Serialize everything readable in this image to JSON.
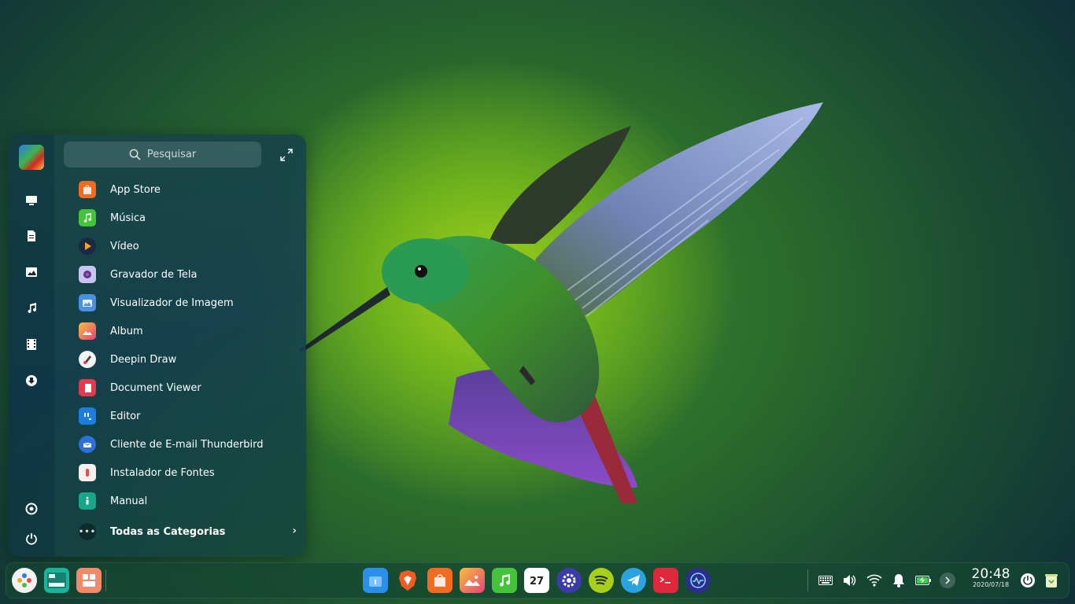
{
  "wallpaper": {
    "subject": "hummingbird",
    "accent": "#8fcf1e"
  },
  "launcher": {
    "avatar_icon": "user-avatar-parrot-icon",
    "sidebar": [
      {
        "icon": "computer-icon"
      },
      {
        "icon": "document-icon"
      },
      {
        "icon": "picture-icon"
      },
      {
        "icon": "music-icon"
      },
      {
        "icon": "video-icon"
      },
      {
        "icon": "download-icon"
      },
      {
        "icon": "settings-icon"
      },
      {
        "icon": "power-icon"
      }
    ],
    "search_placeholder": "Pesquisar",
    "apps": [
      {
        "label": "App Store",
        "icon": "app-store-icon",
        "color": "#f26b21"
      },
      {
        "label": "Música",
        "icon": "music-app-icon",
        "color": "#45c43b"
      },
      {
        "label": "Vídeo",
        "icon": "video-app-icon",
        "color": "#2c6bd6"
      },
      {
        "label": "Gravador de Tela",
        "icon": "screen-recorder-icon",
        "color": "#c9c3f0"
      },
      {
        "label": "Visualizador de Imagem",
        "icon": "image-viewer-icon",
        "color": "#4a8fe0"
      },
      {
        "label": "Album",
        "icon": "album-icon",
        "color": "#f08a1f"
      },
      {
        "label": "Deepin Draw",
        "icon": "deepin-draw-icon",
        "color": "#f4f4f4"
      },
      {
        "label": "Document Viewer",
        "icon": "document-viewer-icon",
        "color": "#e53a4e"
      },
      {
        "label": "Editor",
        "icon": "editor-icon",
        "color": "#1a7fe0"
      },
      {
        "label": "Cliente de E-mail Thunderbird",
        "icon": "thunderbird-icon",
        "color": "#2f6fd8"
      },
      {
        "label": "Instalador de Fontes",
        "icon": "font-installer-icon",
        "color": "#f6f1ee"
      },
      {
        "label": "Manual",
        "icon": "manual-icon",
        "color": "#18a58b"
      }
    ],
    "all_categories": "Todas as Categorias"
  },
  "dock": {
    "left": [
      {
        "name": "launcher-icon"
      },
      {
        "name": "multitasking-icon"
      },
      {
        "name": "workspaces-icon"
      }
    ],
    "apps": [
      {
        "name": "file-manager-icon",
        "color": "#2b8ee8"
      },
      {
        "name": "brave-browser-icon",
        "color": "#f25b1f"
      },
      {
        "name": "app-store-icon",
        "color": "#f26b21"
      },
      {
        "name": "album-icon",
        "color": "#f08a1f"
      },
      {
        "name": "music-app-icon",
        "color": "#45c43b"
      },
      {
        "name": "calendar-icon",
        "color": "#ffffff",
        "text": "27"
      },
      {
        "name": "control-center-icon",
        "color": "#3c3ca8"
      },
      {
        "name": "spotify-icon",
        "color": "#1db954"
      },
      {
        "name": "telegram-icon",
        "color": "#2ba3e0"
      },
      {
        "name": "terminal-icon",
        "color": "#e0283c"
      },
      {
        "name": "system-monitor-icon",
        "color": "#2d2d8f"
      }
    ],
    "tray": [
      {
        "name": "keyboard-icon"
      },
      {
        "name": "volume-icon"
      },
      {
        "name": "wifi-icon"
      },
      {
        "name": "notifications-icon"
      },
      {
        "name": "battery-icon"
      },
      {
        "name": "expand-tray-icon"
      }
    ],
    "clock": {
      "time": "20:48",
      "date": "2020/07/18"
    },
    "power_icon": "power-icon",
    "trash_icon": "trash-icon"
  }
}
